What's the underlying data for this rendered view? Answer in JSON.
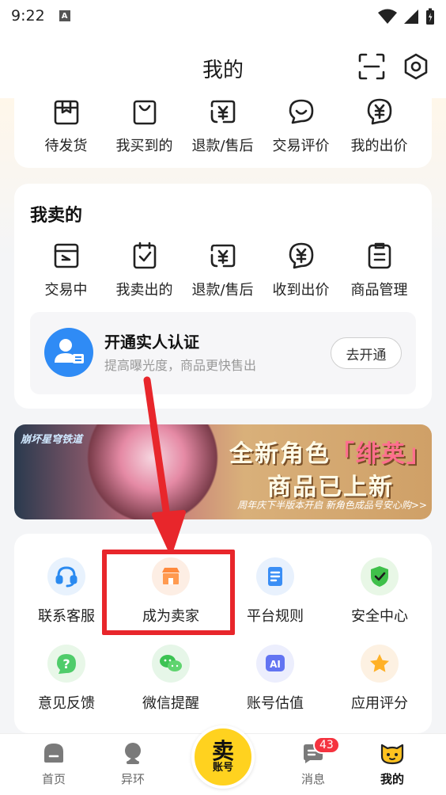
{
  "status_bar": {
    "time": "9:22",
    "notification_letter": "A"
  },
  "header": {
    "title": "我的"
  },
  "orders": {
    "items": [
      {
        "label": "待发货",
        "icon": "box-icon"
      },
      {
        "label": "我买到的",
        "icon": "bag-icon"
      },
      {
        "label": "退款/售后",
        "icon": "refund-icon"
      },
      {
        "label": "交易评价",
        "icon": "review-icon"
      },
      {
        "label": "我的出价",
        "icon": "bid-icon"
      }
    ]
  },
  "selling": {
    "title": "我卖的",
    "items": [
      {
        "label": "交易中",
        "icon": "trading-icon"
      },
      {
        "label": "我卖出的",
        "icon": "sold-icon"
      },
      {
        "label": "退款/售后",
        "icon": "refund-icon"
      },
      {
        "label": "收到出价",
        "icon": "received-bid-icon"
      },
      {
        "label": "商品管理",
        "icon": "manage-icon"
      }
    ],
    "verify": {
      "title": "开通实人认证",
      "subtitle": "提高曝光度，商品更快售出",
      "button": "去开通"
    }
  },
  "banner": {
    "logo": "崩坏星穹铁道",
    "line1_a": "全新角色",
    "line1_b": "「绯英」",
    "line2": "商品已上新",
    "footer": "周年庆下半版本开启  新角色成品号安心购>>"
  },
  "tools": {
    "row1": [
      {
        "label": "联系客服",
        "icon": "headset-icon",
        "color": "#e8f2fd"
      },
      {
        "label": "成为卖家",
        "icon": "shop-icon",
        "color": "#fdeee4"
      },
      {
        "label": "平台规则",
        "icon": "document-icon",
        "color": "#e8f1fd"
      },
      {
        "label": "安全中心",
        "icon": "shield-icon",
        "color": "#e8f7e6"
      }
    ],
    "row2": [
      {
        "label": "意见反馈",
        "icon": "question-icon",
        "color": "#e8f7e8"
      },
      {
        "label": "微信提醒",
        "icon": "wechat-icon",
        "color": "#e6f6e8"
      },
      {
        "label": "账号估值",
        "icon": "ai-icon",
        "color": "#eceefd"
      },
      {
        "label": "应用评分",
        "icon": "star-icon",
        "color": "#fdf1e2"
      }
    ]
  },
  "nav": {
    "home": "首页",
    "ring": "异环",
    "sell_big": "卖",
    "sell_small": "账号",
    "messages": "消息",
    "messages_badge": "43",
    "mine": "我的"
  }
}
